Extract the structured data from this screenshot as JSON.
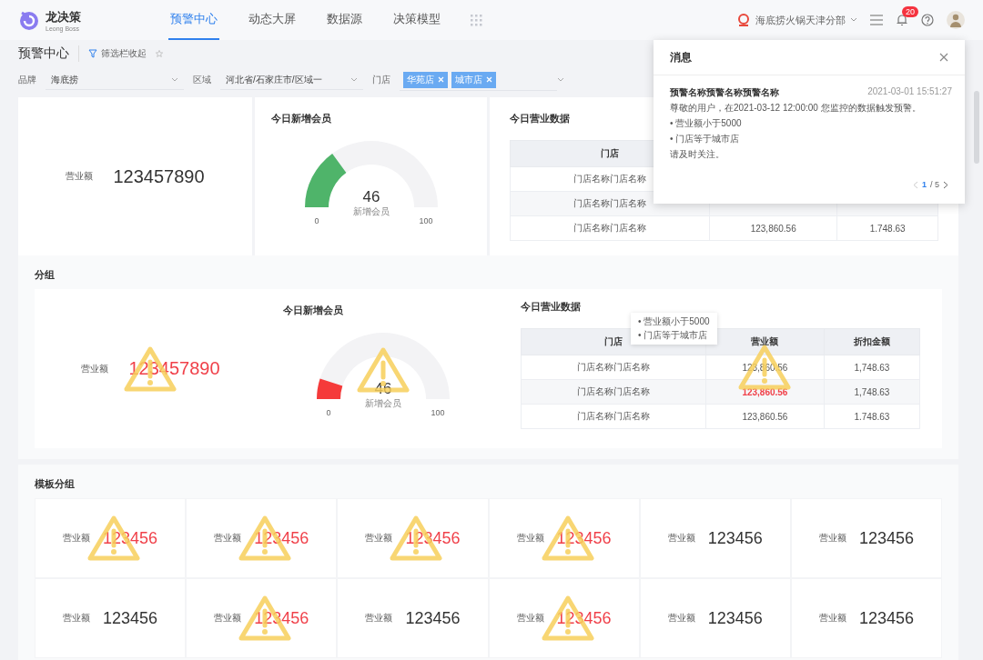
{
  "app": {
    "name": "龙决策",
    "subtitle": "Leong Boss"
  },
  "nav": [
    {
      "label": "预警中心",
      "selected": true
    },
    {
      "label": "动态大屏",
      "selected": false
    },
    {
      "label": "数据源",
      "selected": false
    },
    {
      "label": "决策模型",
      "selected": false
    }
  ],
  "store_switcher": "海底捞火锅天津分部",
  "notification_count": "20",
  "page_title": "预警中心",
  "filter_toggle": "筛选栏收起",
  "filters": [
    {
      "kind": "select",
      "label": "品牌",
      "value": "海底捞"
    },
    {
      "kind": "select",
      "label": "区域",
      "value": "河北省/石家庄市/区域一"
    },
    {
      "kind": "tags",
      "label": "门店",
      "tags": [
        "华苑店",
        "城市店"
      ]
    }
  ],
  "overview": {
    "kpi": {
      "label": "营业额",
      "value": "123457890",
      "alert": false
    },
    "gauge": {
      "title": "今日新增会员",
      "value": "46",
      "caption": "新增会员",
      "min": "0",
      "max": "100",
      "level": 0.3,
      "alert": false
    },
    "table": {
      "title": "今日营业数据",
      "columns": [
        "门店"
      ],
      "rows": [
        {
          "cells": [
            {
              "text": "门店名称门店名称",
              "alert": false
            }
          ]
        },
        {
          "cells": [
            {
              "text": "门店名称门店名称",
              "alert": false
            }
          ]
        },
        {
          "cells": [
            {
              "text": "门店名称门店名称",
              "alert": false
            },
            {
              "text": "123,860.56",
              "alert": false
            },
            {
              "text": "1.748.63",
              "alert": false
            }
          ]
        }
      ]
    }
  },
  "group": {
    "title": "分组",
    "kpi": {
      "label": "营业额",
      "value": "123457890",
      "alert": true
    },
    "gauge": {
      "title": "今日新增会员",
      "value": "46",
      "caption": "新增会员",
      "min": "0",
      "max": "100",
      "level": 0.1,
      "alert": true
    },
    "table": {
      "title": "今日营业数据",
      "columns": [
        "门店",
        "营业额",
        "折扣金额"
      ],
      "rows": [
        {
          "cells": [
            {
              "text": "门店名称门店名称",
              "alert": false
            },
            {
              "text": "123,860.56",
              "alert": false
            },
            {
              "text": "1,748.63",
              "alert": false
            }
          ]
        },
        {
          "cells": [
            {
              "text": "门店名称门店名称",
              "alert": false
            },
            {
              "text": "123,860.56",
              "alert": true
            },
            {
              "text": "1,748.63",
              "alert": false
            }
          ]
        },
        {
          "cells": [
            {
              "text": "门店名称门店名称",
              "alert": false
            },
            {
              "text": "123,860.56",
              "alert": false
            },
            {
              "text": "1.748.63",
              "alert": false
            }
          ]
        }
      ]
    },
    "tooltip": [
      "• 营业额小于5000",
      "• 门店等于城市店"
    ]
  },
  "template_group": {
    "title": "模板分组",
    "items": [
      {
        "label": "营业额",
        "value": "123456",
        "alert": true
      },
      {
        "label": "营业额",
        "value": "123456",
        "alert": true
      },
      {
        "label": "营业额",
        "value": "123456",
        "alert": true
      },
      {
        "label": "营业额",
        "value": "123456",
        "alert": true
      },
      {
        "label": "营业额",
        "value": "123456",
        "alert": false
      },
      {
        "label": "营业额",
        "value": "123456",
        "alert": false
      },
      {
        "label": "营业额",
        "value": "123456",
        "alert": false
      },
      {
        "label": "营业额",
        "value": "123456",
        "alert": true
      },
      {
        "label": "营业额",
        "value": "123456",
        "alert": false
      },
      {
        "label": "营业额",
        "value": "123456",
        "alert": true
      },
      {
        "label": "营业额",
        "value": "123456",
        "alert": false
      },
      {
        "label": "营业额",
        "value": "123456",
        "alert": false
      }
    ]
  },
  "message_panel": {
    "title": "消息",
    "item_title": "预警名称预警名称预警名称",
    "time": "2021-03-01 15:51:27",
    "lines": [
      "尊敬的用户，在2021-03-12 12:00:00 您监控的数据触发预警。",
      "• 营业额小于5000",
      "• 门店等于城市店",
      "请及时关注。"
    ],
    "pager": {
      "current": "1",
      "total": "/ 5"
    }
  }
}
